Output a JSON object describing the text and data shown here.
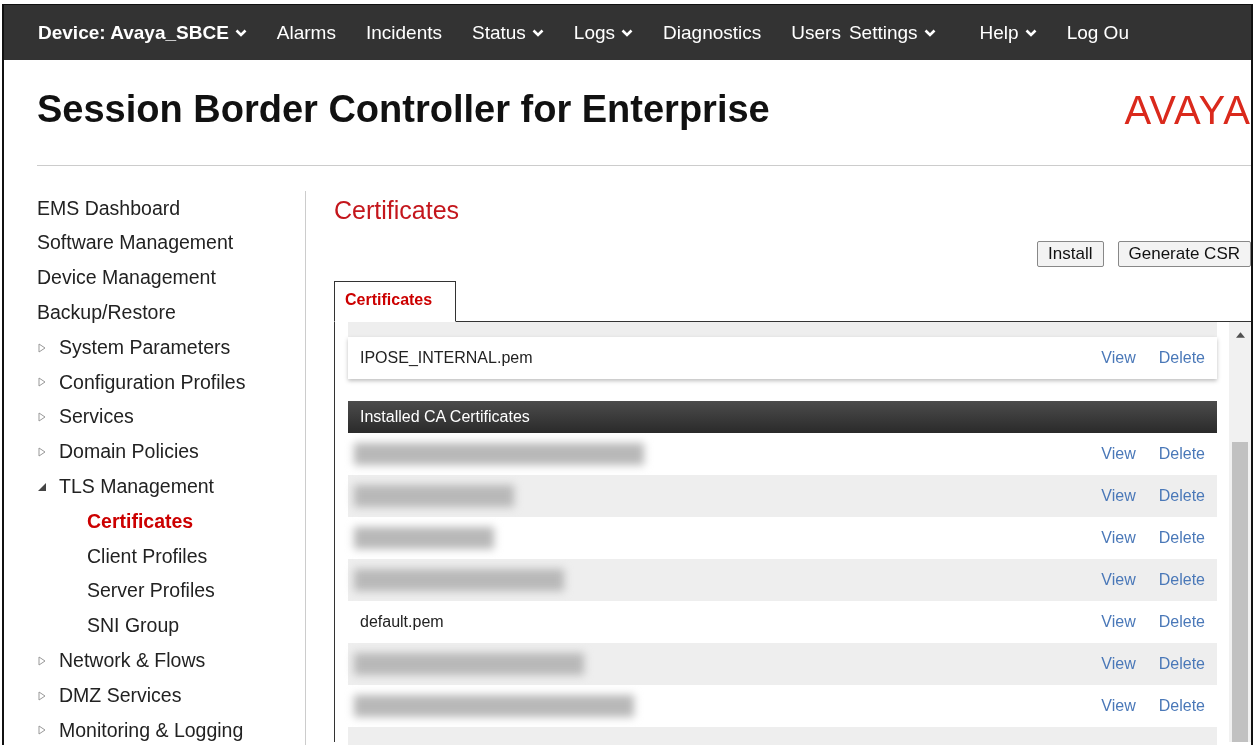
{
  "nav": [
    {
      "label": "Device: Avaya_SBCE",
      "bold": true,
      "dropdown": true
    },
    {
      "label": "Alarms",
      "bold": false,
      "dropdown": false
    },
    {
      "label": "Incidents",
      "bold": false,
      "dropdown": false
    },
    {
      "label": "Status",
      "bold": false,
      "dropdown": true
    },
    {
      "label": "Logs",
      "bold": false,
      "dropdown": true
    },
    {
      "label": "Diagnostics",
      "bold": false,
      "dropdown": false
    },
    {
      "label": "Users",
      "bold": false,
      "dropdown": false
    },
    {
      "label": "Settings",
      "bold": false,
      "dropdown": true
    },
    {
      "label": "Help",
      "bold": false,
      "dropdown": true
    },
    {
      "label": "Log Ou",
      "bold": false,
      "dropdown": false
    }
  ],
  "header": {
    "title": "Session Border Controller for Enterprise",
    "logo": "AVAYA"
  },
  "sidebar": {
    "items": [
      {
        "label": "EMS Dashboard",
        "selected": false
      },
      {
        "label": "Software Management",
        "selected": false
      },
      {
        "label": "Device Management",
        "selected": false
      },
      {
        "label": "Backup/Restore",
        "selected": false
      },
      {
        "label": "System Parameters",
        "selected": false,
        "expanded": false
      },
      {
        "label": "Configuration Profiles",
        "selected": false,
        "expanded": false
      },
      {
        "label": "Services",
        "selected": false,
        "expanded": false
      },
      {
        "label": "Domain Policies",
        "selected": false,
        "expanded": false
      },
      {
        "label": "TLS Management",
        "selected": false,
        "expanded": true,
        "children": [
          {
            "label": "Certificates",
            "selected": true
          },
          {
            "label": "Client Profiles",
            "selected": false
          },
          {
            "label": "Server Profiles",
            "selected": false
          },
          {
            "label": "SNI Group",
            "selected": false
          }
        ]
      },
      {
        "label": "Network & Flows",
        "selected": false,
        "expanded": false
      },
      {
        "label": "DMZ Services",
        "selected": false,
        "expanded": false
      },
      {
        "label": "Monitoring & Logging",
        "selected": false,
        "expanded": false
      }
    ]
  },
  "content": {
    "title": "Certificates",
    "buttons": [
      "Install",
      "Generate CSR"
    ],
    "tabs": [
      {
        "label": "Certificates",
        "selected": true
      }
    ],
    "installed_certificates": {
      "rows": [
        {
          "kind": "text",
          "name": "IPOSE_INTERNAL.pem",
          "actions": [
            "View",
            "Delete"
          ]
        }
      ]
    },
    "ca_certificates": {
      "title": "Installed CA Certificates",
      "rows": [
        {
          "kind": "redacted",
          "actions": [
            "View",
            "Delete"
          ]
        },
        {
          "kind": "redacted",
          "actions": [
            "View",
            "Delete"
          ]
        },
        {
          "kind": "redacted",
          "actions": [
            "View",
            "Delete"
          ]
        },
        {
          "kind": "redacted",
          "actions": [
            "View",
            "Delete"
          ]
        },
        {
          "kind": "text",
          "name": "default.pem",
          "actions": [
            "View",
            "Delete"
          ]
        },
        {
          "kind": "redacted",
          "actions": [
            "View",
            "Delete"
          ]
        },
        {
          "kind": "redacted",
          "actions": [
            "View",
            "Delete"
          ]
        }
      ]
    }
  }
}
